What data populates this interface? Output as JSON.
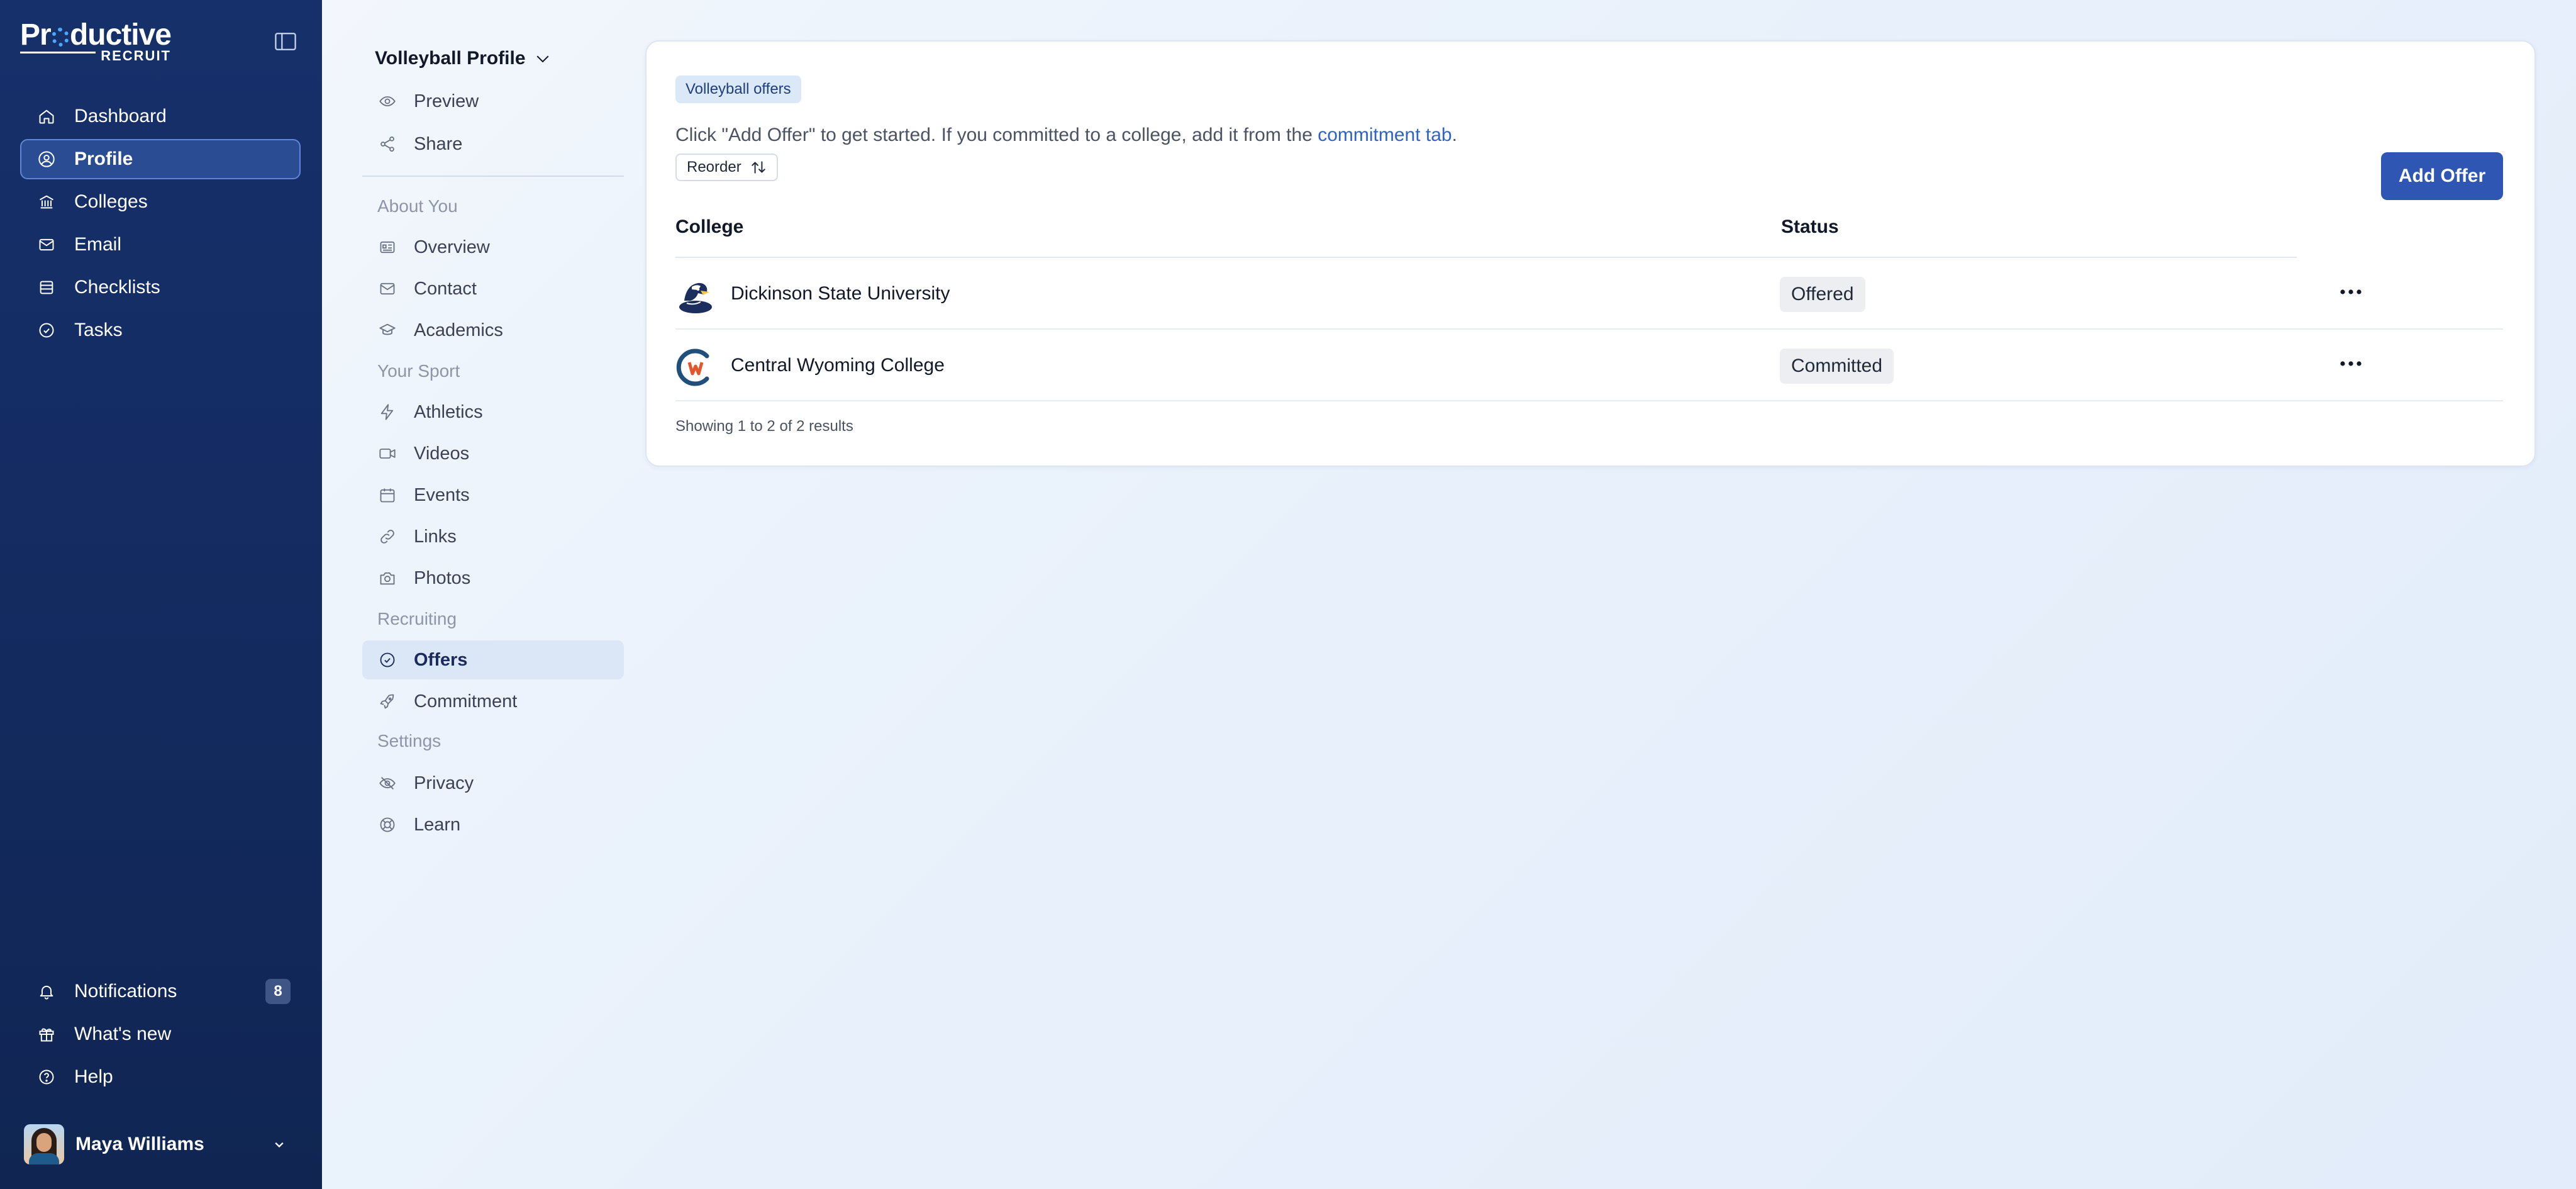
{
  "app": {
    "logo_text_before": "Pr",
    "logo_text_after": "ductive",
    "logo_sub": "RECRUIT",
    "accent": "#2f56b3",
    "sidebar_bg": "#16306b"
  },
  "sidebar": {
    "main_items": [
      {
        "label": "Dashboard",
        "icon": "home-icon",
        "active": false
      },
      {
        "label": "Profile",
        "icon": "user-circle-icon",
        "active": true
      },
      {
        "label": "Colleges",
        "icon": "building-icon",
        "active": false
      },
      {
        "label": "Email",
        "icon": "mail-icon",
        "active": false
      },
      {
        "label": "Checklists",
        "icon": "list-icon",
        "active": false
      },
      {
        "label": "Tasks",
        "icon": "check-circle-icon",
        "active": false
      }
    ],
    "bottom_items": [
      {
        "label": "Notifications",
        "icon": "bell-icon",
        "badge": "8"
      },
      {
        "label": "What's new",
        "icon": "gift-icon"
      },
      {
        "label": "Help",
        "icon": "help-circle-icon"
      }
    ],
    "user": {
      "name": "Maya Williams"
    }
  },
  "subnav": {
    "profile_label": "Volleyball Profile",
    "top_items": [
      {
        "label": "Preview",
        "icon": "eye-icon"
      },
      {
        "label": "Share",
        "icon": "share-icon"
      }
    ],
    "sections": [
      {
        "title": "About You",
        "items": [
          {
            "label": "Overview",
            "icon": "id-card-icon"
          },
          {
            "label": "Contact",
            "icon": "mail-icon"
          },
          {
            "label": "Academics",
            "icon": "graduation-cap-icon"
          }
        ]
      },
      {
        "title": "Your Sport",
        "items": [
          {
            "label": "Athletics",
            "icon": "lightning-icon"
          },
          {
            "label": "Videos",
            "icon": "video-icon"
          },
          {
            "label": "Events",
            "icon": "calendar-icon"
          },
          {
            "label": "Links",
            "icon": "link-icon"
          },
          {
            "label": "Photos",
            "icon": "camera-icon"
          }
        ]
      },
      {
        "title": "Recruiting",
        "items": [
          {
            "label": "Offers",
            "icon": "check-circle-icon",
            "active": true
          },
          {
            "label": "Commitment",
            "icon": "rocket-icon"
          }
        ]
      },
      {
        "title": "Settings",
        "items": [
          {
            "label": "Privacy",
            "icon": "eye-off-icon"
          },
          {
            "label": "Learn",
            "icon": "lifebuoy-icon"
          }
        ]
      }
    ]
  },
  "offers": {
    "badge": "Volleyball offers",
    "description_prefix": "Click \"Add Offer\" to get started. If you committed to a college, add it from the ",
    "description_link": "commitment tab",
    "description_suffix": ".",
    "reorder_label": "Reorder",
    "add_label": "Add Offer",
    "columns": {
      "college": "College",
      "status": "Status"
    },
    "rows": [
      {
        "college": "Dickinson State University",
        "status": "Offered",
        "logo": "blue-hawk-logo"
      },
      {
        "college": "Central Wyoming College",
        "status": "Committed",
        "logo": "cw-logo"
      }
    ],
    "results_text": "Showing 1 to 2 of 2 results"
  }
}
